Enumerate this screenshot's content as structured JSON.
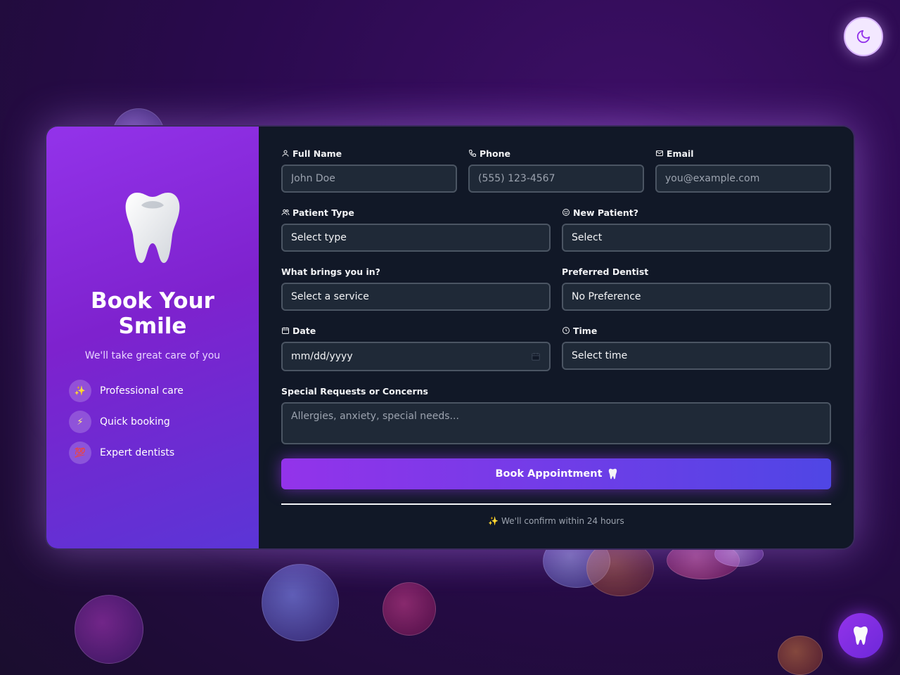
{
  "hero": {
    "title": "Book Your Smile",
    "subtitle": "We'll take great care of you",
    "features": [
      {
        "icon": "sparkles-icon",
        "glyph": "✨",
        "label": "Professional care"
      },
      {
        "icon": "lightning-icon",
        "glyph": "⚡",
        "label": "Quick booking"
      },
      {
        "icon": "hundred-icon",
        "glyph": "💯",
        "label": "Expert dentists"
      }
    ]
  },
  "form": {
    "full_name": {
      "label": "Full Name",
      "placeholder": "John Doe",
      "icon": "user-icon"
    },
    "phone": {
      "label": "Phone",
      "placeholder": "(555) 123-4567",
      "icon": "phone-icon"
    },
    "email": {
      "label": "Email",
      "placeholder": "you@example.com",
      "icon": "mail-icon"
    },
    "patient_type": {
      "label": "Patient Type",
      "value": "Select type",
      "icon": "users-icon"
    },
    "new_patient": {
      "label": "New Patient?",
      "value": "Select",
      "icon": "smile-icon"
    },
    "service": {
      "label": "What brings you in?",
      "value": "Select a service"
    },
    "dentist": {
      "label": "Preferred Dentist",
      "value": "No Preference"
    },
    "date": {
      "label": "Date",
      "value": "mm/dd/yyyy",
      "icon": "calendar-icon"
    },
    "time": {
      "label": "Time",
      "value": "Select time",
      "icon": "clock-icon"
    },
    "requests": {
      "label": "Special Requests or Concerns",
      "placeholder": "Allergies, anxiety, special needs..."
    },
    "submit_label": "Book Appointment",
    "confirm_note": "✨ We'll confirm within 24 hours"
  },
  "colors": {
    "accent": "#9333ea",
    "accent_end": "#4f46e5",
    "panel_bg": "#111827",
    "input_bg": "#1f2937"
  }
}
